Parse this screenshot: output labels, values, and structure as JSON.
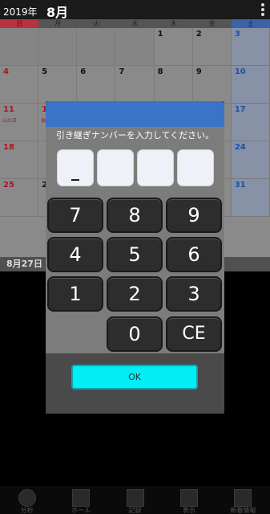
{
  "header": {
    "year": "2019年",
    "month": "8月"
  },
  "weekdays": [
    "日",
    "月",
    "火",
    "水",
    "木",
    "金",
    "土"
  ],
  "calendar": {
    "weeks": [
      [
        "",
        "",
        "",
        "",
        "1",
        "2",
        "3"
      ],
      [
        "4",
        "5",
        "6",
        "7",
        "8",
        "9",
        "10"
      ],
      [
        "11",
        "12",
        "",
        "",
        "",
        "",
        "17"
      ],
      [
        "18",
        "",
        "",
        "",
        "",
        "",
        "24"
      ],
      [
        "25",
        "26",
        "",
        "",
        "",
        "",
        "31"
      ]
    ],
    "notes": {
      "w2c0": "山の日",
      "w2c1": "振替"
    },
    "footer_date": "8月27日"
  },
  "dialog": {
    "message": "引き継ぎナンバーを入力してください。",
    "digits": [
      "_",
      "",
      "",
      ""
    ],
    "keys": [
      "7",
      "8",
      "9",
      "4",
      "5",
      "6",
      "1",
      "2",
      "3",
      "0",
      "CE"
    ],
    "ok_label": "OK"
  },
  "bottom": {
    "tabs": [
      {
        "label": "分析",
        "icon": "clock-icon"
      },
      {
        "label": "ホール",
        "icon": "building-icon"
      },
      {
        "label": "記録",
        "icon": "slot-icon"
      },
      {
        "label": "表示",
        "icon": "window-icon"
      },
      {
        "label": "新着情報",
        "icon": "alert-icon"
      }
    ]
  },
  "colors": {
    "sunday": "#b8333e",
    "saturday": "#3d63a8",
    "dialog_title": "#3b73c6",
    "ok_button": "#00eef4"
  }
}
